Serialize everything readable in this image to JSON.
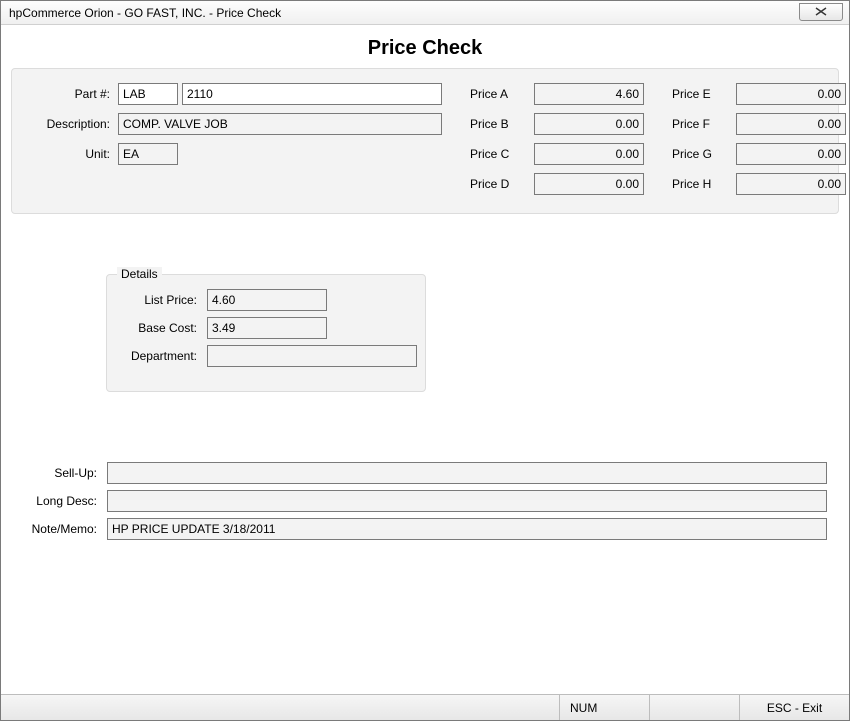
{
  "window": {
    "title": "hpCommerce Orion - GO FAST, INC. - Price Check"
  },
  "page": {
    "title": "Price Check"
  },
  "part": {
    "label": "Part #:",
    "prefix": "LAB",
    "number": "2110",
    "description_label": "Description:",
    "description": "COMP. VALVE JOB",
    "unit_label": "Unit:",
    "unit": "EA"
  },
  "prices_left": [
    {
      "label": "Price A",
      "value": "4.60"
    },
    {
      "label": "Price B",
      "value": "0.00"
    },
    {
      "label": "Price C",
      "value": "0.00"
    },
    {
      "label": "Price D",
      "value": "0.00"
    }
  ],
  "prices_right": [
    {
      "label": "Price E",
      "value": "0.00"
    },
    {
      "label": "Price F",
      "value": "0.00"
    },
    {
      "label": "Price G",
      "value": "0.00"
    },
    {
      "label": "Price H",
      "value": "0.00"
    }
  ],
  "details": {
    "legend": "Details",
    "list_price_label": "List Price:",
    "list_price": "4.60",
    "base_cost_label": "Base Cost:",
    "base_cost": "3.49",
    "department_label": "Department:",
    "department": ""
  },
  "notes": {
    "sell_up_label": "Sell-Up:",
    "sell_up": "",
    "long_desc_label": "Long Desc:",
    "long_desc": "",
    "note_memo_label": "Note/Memo:",
    "note_memo": "HP PRICE UPDATE 3/18/2011"
  },
  "status": {
    "num": "NUM",
    "exit": "ESC - Exit"
  }
}
